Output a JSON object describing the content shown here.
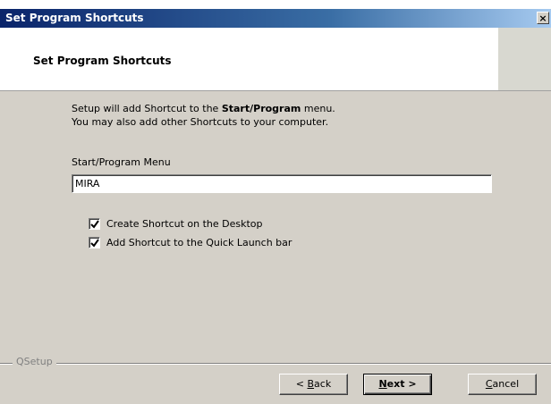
{
  "window": {
    "title": "Set Program Shortcuts",
    "close_glyph": "×"
  },
  "header": {
    "title": "Set Program Shortcuts"
  },
  "intro": {
    "line1_prefix": "Setup will add Shortcut to the ",
    "line1_bold": "Start/Program",
    "line1_suffix": " menu.",
    "line2": "You may also add other Shortcuts to your computer."
  },
  "start_menu": {
    "label": "Start/Program Menu",
    "value": "MIRA"
  },
  "options": [
    {
      "label": "Create Shortcut on the Desktop",
      "checked": true
    },
    {
      "label": "Add Shortcut to the Quick Launch bar",
      "checked": true
    }
  ],
  "group_label": "QSetup",
  "buttons": {
    "back": {
      "prefix": "< ",
      "accel": "B",
      "rest": "ack"
    },
    "next": {
      "accel": "N",
      "rest": "ext >"
    },
    "cancel": {
      "accel": "C",
      "rest": "ancel"
    }
  },
  "colors": {
    "titlebar": "#0a246a",
    "dialog_face": "#d4d0c8"
  }
}
